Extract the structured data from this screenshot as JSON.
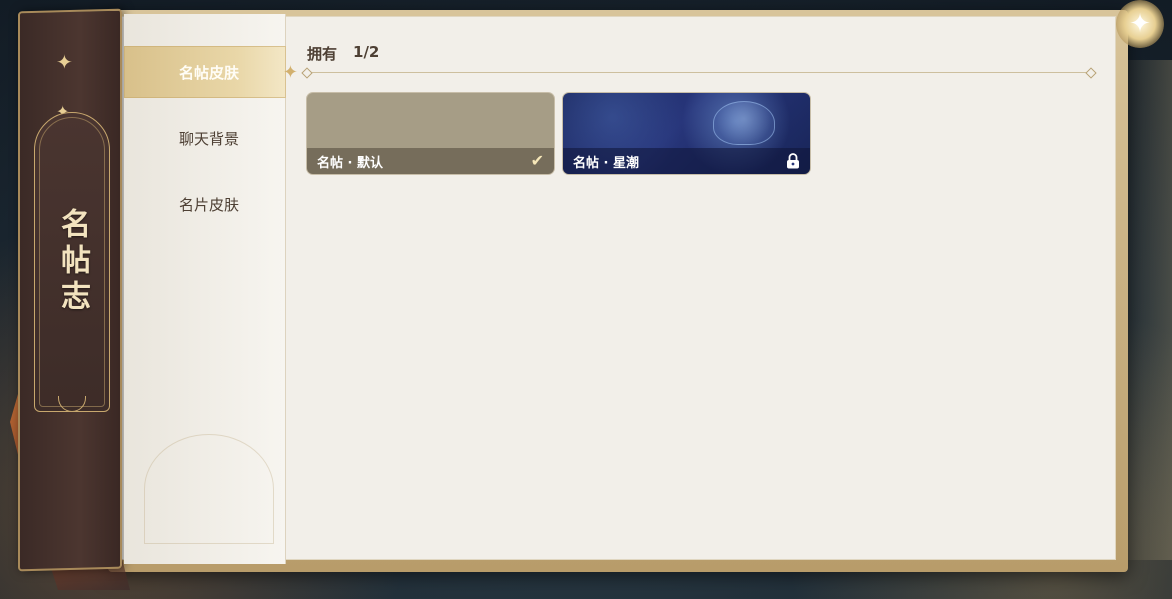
{
  "spine": {
    "title": "名帖志"
  },
  "sidebar": {
    "items": [
      {
        "label": "名帖皮肤",
        "active": true
      },
      {
        "label": "聊天背景",
        "active": false
      },
      {
        "label": "名片皮肤",
        "active": false
      }
    ]
  },
  "content": {
    "owned_label": "拥有",
    "owned_count": "1/2",
    "cards": [
      {
        "name": "名帖 · 默认",
        "status_icon": "checkmark-icon",
        "selected": true,
        "locked": false
      },
      {
        "name": "名帖 · 星潮",
        "status_icon": "lock-icon",
        "selected": false,
        "locked": true
      }
    ]
  },
  "colors": {
    "accent_gold": "#d8c08a",
    "card_default": "#a69d86",
    "card_star": "#27357a",
    "spine": "#3b2a26"
  }
}
